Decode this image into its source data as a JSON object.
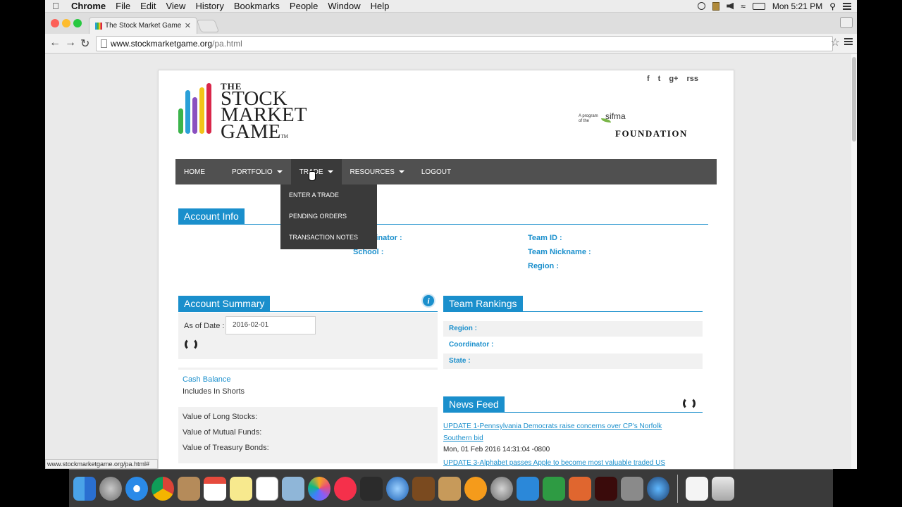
{
  "menubar": {
    "app": "Chrome",
    "items": [
      "File",
      "Edit",
      "View",
      "History",
      "Bookmarks",
      "People",
      "Window",
      "Help"
    ],
    "clock": "Mon 5:21 PM"
  },
  "browser": {
    "tab_title": "The Stock Market Game",
    "url_host": "www.stockmarketgame.org",
    "url_path": "/pa.html",
    "status_url": "www.stockmarketgame.org/pa.html#"
  },
  "logo": {
    "the": "THE",
    "line1": "STOCK",
    "line2": "MARKET",
    "line3": "GAME",
    "tm": "TM"
  },
  "sponsor": {
    "a_program": "A program of the",
    "sifma": "sifma",
    "foundation": "FOUNDATION"
  },
  "social": [
    "f",
    "t",
    "g+",
    "rss"
  ],
  "nav": {
    "home": "HOME",
    "portfolio": "PORTFOLIO",
    "trade": "TRADE",
    "resources": "RESOURCES",
    "logout": "LOGOUT",
    "trade_menu": [
      "ENTER A TRADE",
      "PENDING ORDERS",
      "TRANSACTION NOTES"
    ]
  },
  "account_info": {
    "title": "Account Info",
    "coordinator_label": "Coordinator :",
    "school_label": "School :",
    "team_id_label": "Team ID :",
    "team_nickname_label": "Team Nickname :",
    "region_label": "Region :"
  },
  "account_summary": {
    "title": "Account Summary",
    "as_of_label": "As of Date :",
    "as_of_value": "2016-02-01",
    "cash_balance": "Cash Balance",
    "includes_shorts": "Includes In Shorts",
    "long_stocks": "Value of Long Stocks:",
    "mutual_funds": "Value of Mutual Funds:",
    "treasury_bonds": "Value of Treasury Bonds:"
  },
  "team_rankings": {
    "title": "Team Rankings",
    "region_label": "Region :",
    "coordinator_label": "Coordinator :",
    "state_label": "State :"
  },
  "news_feed": {
    "title": "News Feed",
    "items": [
      {
        "headline": "UPDATE 1-Pennsylvania Democrats raise concerns over CP's Norfolk Southern bid",
        "date": "Mon, 01 Feb 2016 14:31:04 -0800"
      },
      {
        "headline": "UPDATE 3-Alphabet passes Apple to become most valuable traded US",
        "date": ""
      }
    ]
  },
  "colors": {
    "accent": "#1a8fcc",
    "nav_bg": "#505050",
    "dropdown_bg": "#3a3a3a"
  }
}
